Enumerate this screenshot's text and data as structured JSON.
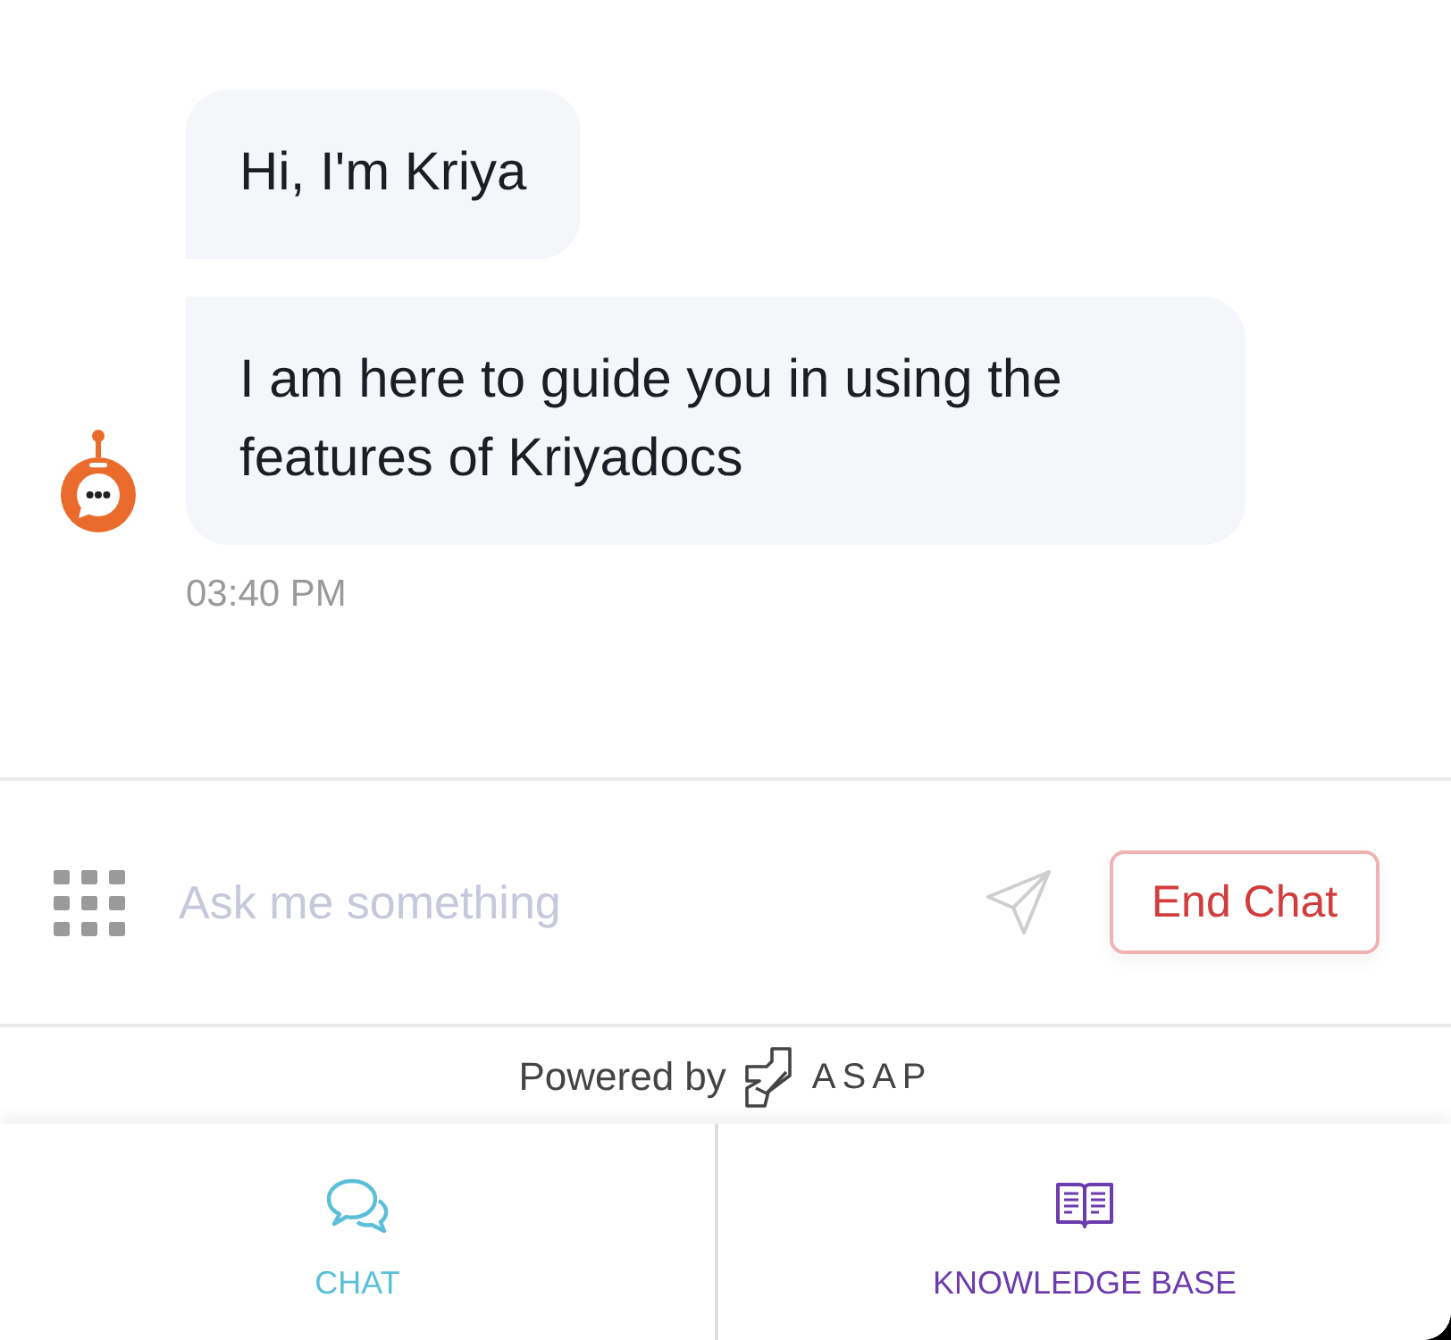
{
  "messages": [
    {
      "text": "Hi, I'm Kriya"
    },
    {
      "text": "I am here to guide you in using the features of Kriyadocs"
    }
  ],
  "timestamp": "03:40 PM",
  "composer": {
    "placeholder": "Ask me something",
    "end_chat_button": "End Chat"
  },
  "footer": {
    "label": "Powered by",
    "brand": "ASAP"
  },
  "tabs": [
    {
      "kind": "chat",
      "label": "CHAT",
      "color": "#5bbfd9"
    },
    {
      "kind": "knowledge",
      "label": "KNOWLEDGE BASE",
      "color": "#6c3bae"
    }
  ]
}
